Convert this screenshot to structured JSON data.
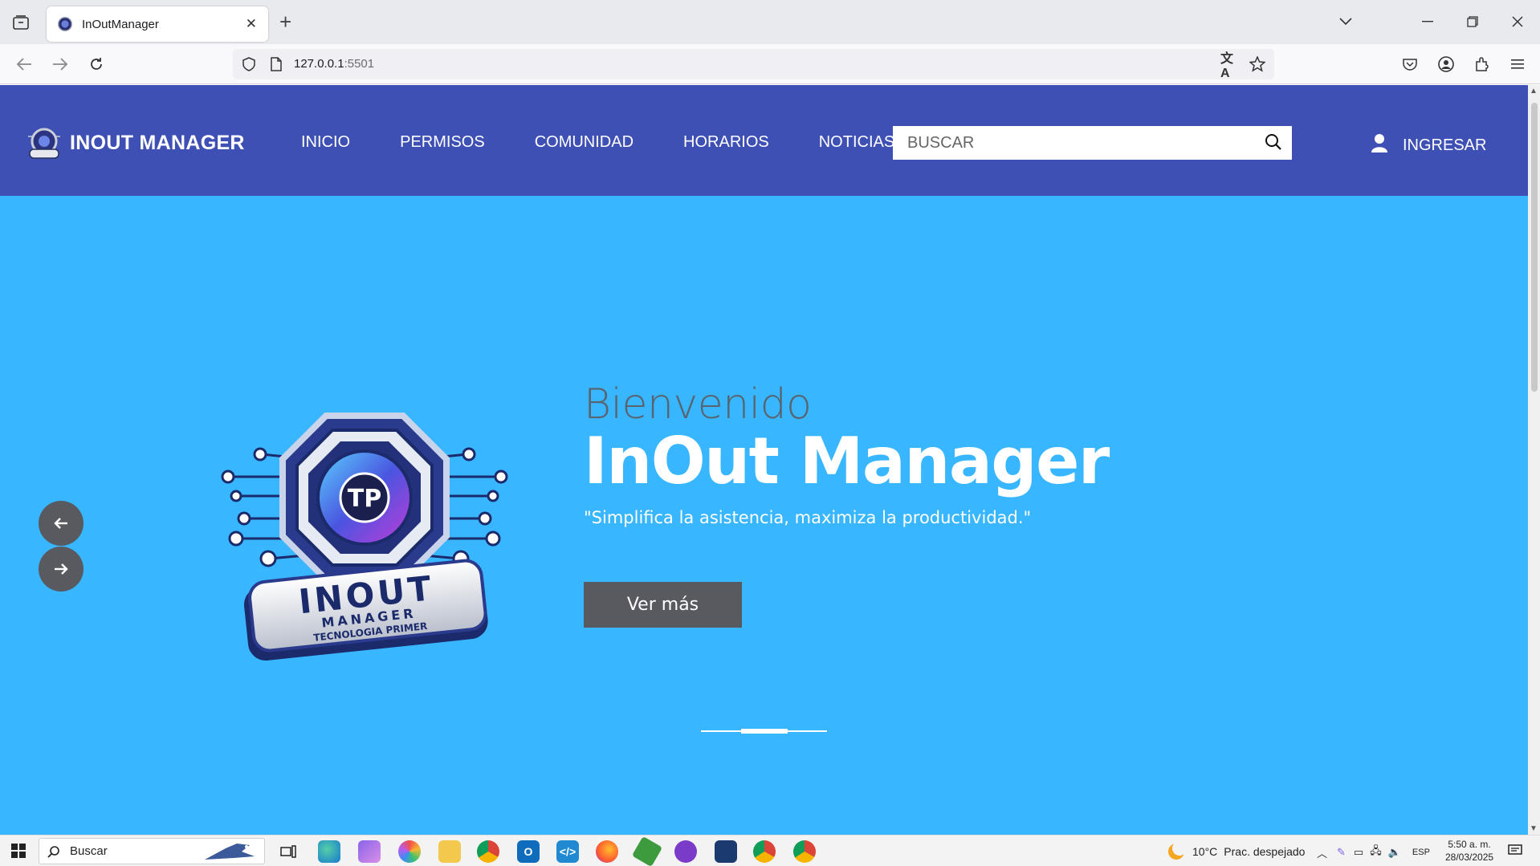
{
  "browser": {
    "tab_title": "InOutManager",
    "url_host": "127.0.0.1",
    "url_port": ":5501"
  },
  "header": {
    "brand": "INOUT MANAGER",
    "menu": [
      "INICIO",
      "PERMISOS",
      "COMUNIDAD",
      "HORARIOS",
      "NOTICIAS"
    ],
    "search_placeholder": "BUSCAR",
    "login_label": "INGRESAR"
  },
  "hero": {
    "welcome": "Bienvenido",
    "title": "InOut Manager",
    "subtitle": "\"Simplifica la asistencia, maximiza la productividad.\"",
    "button_label": "Ver más",
    "logo_text_main": "INOUT",
    "logo_text_sub": "MANAGER",
    "logo_text_tag": "TECNOLOGIA PRIMER",
    "logo_badge": "TP"
  },
  "taskbar": {
    "search_label": "Buscar",
    "weather_temp": "10°C",
    "weather_desc": "Prac. despejado",
    "language": "ESP",
    "time": "5:50 a. m.",
    "date": "28/03/2025"
  },
  "colors": {
    "header_bg": "#3f50b5",
    "hero_bg": "#38b6ff",
    "button_bg": "#595a5f"
  }
}
